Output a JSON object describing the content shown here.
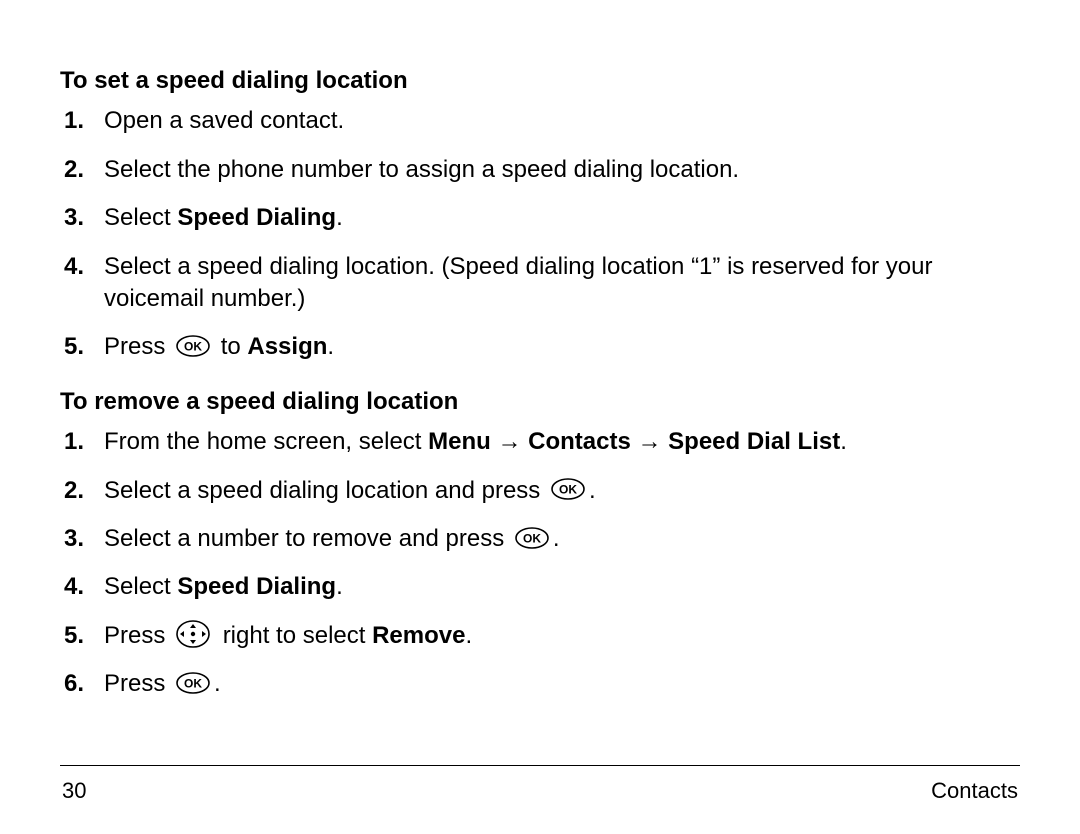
{
  "section1": {
    "heading": "To set a speed dialing location",
    "steps": [
      {
        "n": "1.",
        "pre": "Open a saved contact."
      },
      {
        "n": "2.",
        "pre": "Select the phone number to assign a speed dialing location."
      },
      {
        "n": "3.",
        "pre": "Select ",
        "bold": "Speed Dialing",
        "post": "."
      },
      {
        "n": "4.",
        "pre": "Select a speed dialing location. (Speed dialing location “1” is reserved for your voicemail number.)"
      },
      {
        "n": "5.",
        "pre": "Press ",
        "icon": "ok",
        "mid": " to ",
        "bold": "Assign",
        "post": "."
      }
    ]
  },
  "section2": {
    "heading": "To remove a speed dialing location",
    "steps": [
      {
        "n": "1.",
        "pre": "From the home screen, select ",
        "bold": "Menu → Contacts → Speed Dial List",
        "post": "."
      },
      {
        "n": "2.",
        "pre": "Select a speed dialing location and press ",
        "icon": "ok",
        "post": "."
      },
      {
        "n": "3.",
        "pre": "Select a number to remove and press ",
        "icon": "ok",
        "post": "."
      },
      {
        "n": "4.",
        "pre": "Select ",
        "bold": "Speed Dialing",
        "post": "."
      },
      {
        "n": "5.",
        "pre": "Press ",
        "icon": "nav",
        "mid": " right to select ",
        "bold": "Remove",
        "post": "."
      },
      {
        "n": "6.",
        "pre": "Press ",
        "icon": "ok",
        "post": "."
      }
    ]
  },
  "footer": {
    "page": "30",
    "chapter": "Contacts"
  }
}
